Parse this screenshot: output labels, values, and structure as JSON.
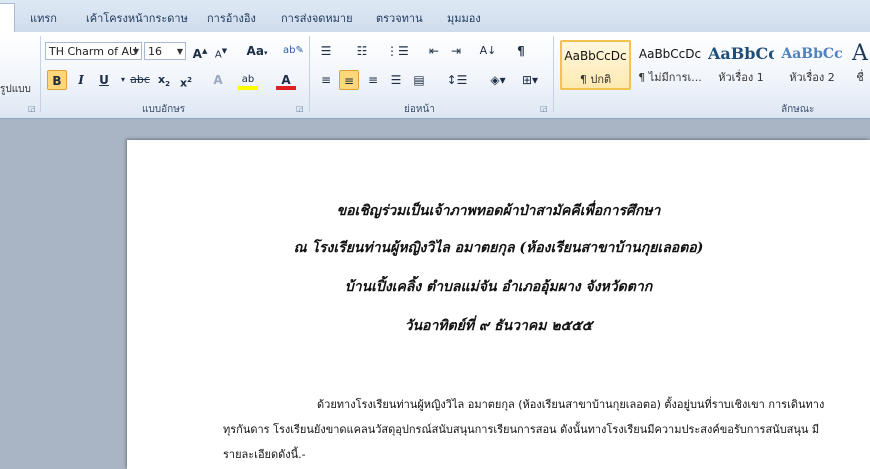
{
  "tabs": [
    "แทรก",
    "เค้าโครงหน้ากระดาษ",
    "การอ้างอิง",
    "การส่งจดหมาย",
    "ตรวจทาน",
    "มุมมอง"
  ],
  "ribbon": {
    "clipboard_label": "รูปแบบ",
    "font": {
      "name": "TH Charm of AU",
      "size": "16",
      "group_label": "แบบอักษร"
    },
    "paragraph": {
      "group_label": "ย่อหน้า"
    },
    "styles": {
      "group_label": "ลักษณะ",
      "items": [
        {
          "sample": "AaBbCcDc",
          "name": "¶ ปกติ",
          "selected": true
        },
        {
          "sample": "AaBbCcDc",
          "name": "¶ ไม่มีการเ...",
          "selected": false
        },
        {
          "sample": "AaBbCc",
          "name": "หัวเรื่อง 1",
          "selected": false
        },
        {
          "sample": "AaBbCc",
          "name": "หัวเรื่อง 2",
          "selected": false
        },
        {
          "sample": "A",
          "name": "ชื่",
          "selected": false
        }
      ]
    },
    "colors": {
      "highlight": "#ffff00",
      "font_color": "#e02020",
      "accent": "#f2c14e"
    }
  },
  "document": {
    "title_lines": [
      "ขอเชิญร่วมเป็นเจ้าภาพทอดผ้าป่าสามัคคีเพื่อการศึกษา",
      "ณ  โรงเรียนท่านผู้หญิงวิไล   อมาตยกุล (ห้องเรียนสาขาบ้านกุยเลอตอ)",
      "บ้านเปิ้งเคลิ้ง  ตำบลแม่จัน  อำเภออุ้มผาง  จังหวัดตาก",
      "วันอาทิตย์ที่  ๙  ธันวาคม  ๒๕๕๕"
    ],
    "body_lines": [
      "ด้วยทางโรงเรียนท่านผู้หญิงวิไล   อมาตยกุล (ห้องเรียนสาขาบ้านกุยเลอตอ)  ตั้งอยู่บนที่ราบเชิงเขา  การเดินทาง",
      "ทุรกันดาร    โรงเรียนยังขาดแคลนวัสดุอุปกรณ์สนับสนุนการเรียนการสอน   ดังนั้นทางโรงเรียนมีความประสงค์ขอรับการสนับสนุน   มี",
      "รายละเอียดดังนี้.-"
    ]
  }
}
